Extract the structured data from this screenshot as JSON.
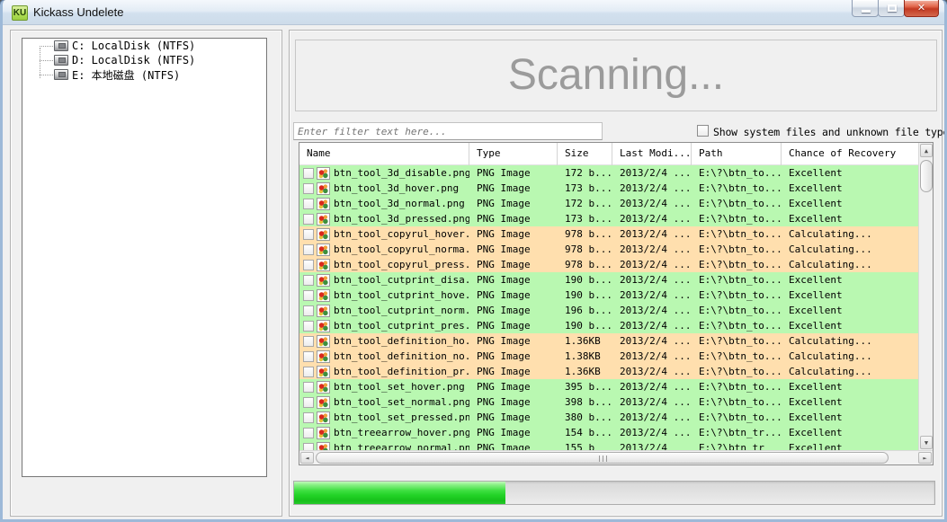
{
  "window": {
    "title": "Kickass Undelete",
    "icon_text": "KU"
  },
  "icons": {
    "close": "✕",
    "scroll_up": "▲",
    "scroll_down": "▼",
    "scroll_left": "◄",
    "scroll_right": "►"
  },
  "drive_tree": {
    "items": [
      {
        "label": "C: LocalDisk (NTFS)"
      },
      {
        "label": "D: LocalDisk (NTFS)"
      },
      {
        "label": "E: 本地磁盘 (NTFS)"
      }
    ]
  },
  "scan_status": {
    "label": "Scanning..."
  },
  "filter": {
    "placeholder": "Enter filter text here...",
    "checkbox_label": "Show system files and unknown file types",
    "checkbox_checked": false
  },
  "file_table": {
    "columns": [
      "Name",
      "Type",
      "Size",
      "Last Modi...",
      "Path",
      "Chance of Recovery"
    ],
    "rows": [
      {
        "name": "btn_tool_3d_disable.png",
        "type": "PNG Image",
        "size": "172 b...",
        "modified": "2013/2/4 ...",
        "path": "E:\\?\\btn_to...",
        "recovery": "Excellent",
        "highlight": "excellent"
      },
      {
        "name": "btn_tool_3d_hover.png",
        "type": "PNG Image",
        "size": "173 b...",
        "modified": "2013/2/4 ...",
        "path": "E:\\?\\btn_to...",
        "recovery": "Excellent",
        "highlight": "excellent"
      },
      {
        "name": "btn_tool_3d_normal.png",
        "type": "PNG Image",
        "size": "172 b...",
        "modified": "2013/2/4 ...",
        "path": "E:\\?\\btn_to...",
        "recovery": "Excellent",
        "highlight": "excellent"
      },
      {
        "name": "btn_tool_3d_pressed.png",
        "type": "PNG Image",
        "size": "173 b...",
        "modified": "2013/2/4 ...",
        "path": "E:\\?\\btn_to...",
        "recovery": "Excellent",
        "highlight": "excellent"
      },
      {
        "name": "btn_tool_copyrul_hover...",
        "type": "PNG Image",
        "size": "978 b...",
        "modified": "2013/2/4 ...",
        "path": "E:\\?\\btn_to...",
        "recovery": "Calculating...",
        "highlight": "calculating"
      },
      {
        "name": "btn_tool_copyrul_norma...",
        "type": "PNG Image",
        "size": "978 b...",
        "modified": "2013/2/4 ...",
        "path": "E:\\?\\btn_to...",
        "recovery": "Calculating...",
        "highlight": "calculating"
      },
      {
        "name": "btn_tool_copyrul_press...",
        "type": "PNG Image",
        "size": "978 b...",
        "modified": "2013/2/4 ...",
        "path": "E:\\?\\btn_to...",
        "recovery": "Calculating...",
        "highlight": "calculating"
      },
      {
        "name": "btn_tool_cutprint_disa...",
        "type": "PNG Image",
        "size": "190 b...",
        "modified": "2013/2/4 ...",
        "path": "E:\\?\\btn_to...",
        "recovery": "Excellent",
        "highlight": "excellent"
      },
      {
        "name": "btn_tool_cutprint_hove...",
        "type": "PNG Image",
        "size": "190 b...",
        "modified": "2013/2/4 ...",
        "path": "E:\\?\\btn_to...",
        "recovery": "Excellent",
        "highlight": "excellent"
      },
      {
        "name": "btn_tool_cutprint_norm...",
        "type": "PNG Image",
        "size": "196 b...",
        "modified": "2013/2/4 ...",
        "path": "E:\\?\\btn_to...",
        "recovery": "Excellent",
        "highlight": "excellent"
      },
      {
        "name": "btn_tool_cutprint_pres...",
        "type": "PNG Image",
        "size": "190 b...",
        "modified": "2013/2/4 ...",
        "path": "E:\\?\\btn_to...",
        "recovery": "Excellent",
        "highlight": "excellent"
      },
      {
        "name": "btn_tool_definition_ho...",
        "type": "PNG Image",
        "size": "1.36KB",
        "modified": "2013/2/4 ...",
        "path": "E:\\?\\btn_to...",
        "recovery": "Calculating...",
        "highlight": "calculating"
      },
      {
        "name": "btn_tool_definition_no...",
        "type": "PNG Image",
        "size": "1.38KB",
        "modified": "2013/2/4 ...",
        "path": "E:\\?\\btn_to...",
        "recovery": "Calculating...",
        "highlight": "calculating"
      },
      {
        "name": "btn_tool_definition_pr...",
        "type": "PNG Image",
        "size": "1.36KB",
        "modified": "2013/2/4 ...",
        "path": "E:\\?\\btn_to...",
        "recovery": "Calculating...",
        "highlight": "calculating"
      },
      {
        "name": "btn_tool_set_hover.png",
        "type": "PNG Image",
        "size": "395 b...",
        "modified": "2013/2/4 ...",
        "path": "E:\\?\\btn_to...",
        "recovery": "Excellent",
        "highlight": "excellent"
      },
      {
        "name": "btn_tool_set_normal.png",
        "type": "PNG Image",
        "size": "398 b...",
        "modified": "2013/2/4 ...",
        "path": "E:\\?\\btn_to...",
        "recovery": "Excellent",
        "highlight": "excellent"
      },
      {
        "name": "btn_tool_set_pressed.png",
        "type": "PNG Image",
        "size": "380 b...",
        "modified": "2013/2/4 ...",
        "path": "E:\\?\\btn_to...",
        "recovery": "Excellent",
        "highlight": "excellent"
      },
      {
        "name": "btn_treearrow_hover.png",
        "type": "PNG Image",
        "size": "154 b...",
        "modified": "2013/2/4 ...",
        "path": "E:\\?\\btn_tr...",
        "recovery": "Excellent",
        "highlight": "excellent"
      },
      {
        "name": "btn_treearrow_normal.png",
        "type": "PNG Image",
        "size": "155 b",
        "modified": "2013/2/4",
        "path": "E:\\?\\btn_tr",
        "recovery": "Excellent",
        "highlight": "excellent"
      }
    ]
  },
  "progress": {
    "percent": 33
  },
  "colors": {
    "row_excellent": "#b9f8b1",
    "row_calculating": "#ffdfae",
    "progress_green": "#2bd72f"
  }
}
